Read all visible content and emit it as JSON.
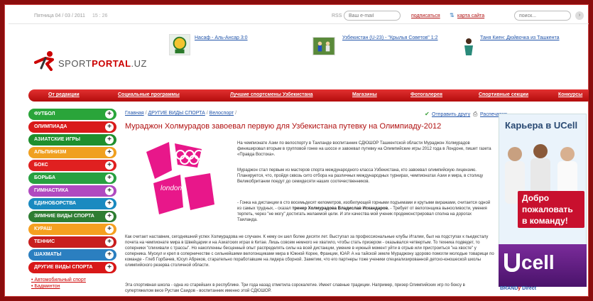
{
  "topbar": {
    "date": "Пятница 04 / 03 / 2011",
    "time": "15 : 26",
    "rss": "RSS",
    "email_placeholder": "Ваш e-mail",
    "subscribe": "подписаться",
    "sitemap": "карта сайта",
    "search_placeholder": "поиск..."
  },
  "logo": {
    "brand_plain": "SPORT",
    "brand_bold": "PORTAL",
    "brand_tail": ".UZ"
  },
  "header_news": [
    {
      "title": "Насаф - Аль-Ансар 3:0"
    },
    {
      "title": "Узбекистан (U-23) - \"Крылья Советов\" 1:2"
    },
    {
      "title": "Таня Киен: Дюйвочка из Ташкента"
    }
  ],
  "nav": {
    "items": [
      "От редакции",
      "Социальные программы",
      "Лучшие спортсмены Узбекистана",
      "Магазины",
      "Фотогалерея",
      "Спортивные секции",
      "Конкурсы"
    ]
  },
  "sidebar": {
    "items": [
      {
        "label": "ФУТБОЛ",
        "color": "#2aa53a"
      },
      {
        "label": "ОЛИМПИАДА",
        "color": "#d91a1a"
      },
      {
        "label": "АЗИАТСКИЕ ИГРЫ",
        "color": "#1f8f2e"
      },
      {
        "label": "АЛЬПИНИЗМ",
        "color": "#f0a020"
      },
      {
        "label": "БОКС",
        "color": "#e02020"
      },
      {
        "label": "БОРЬБА",
        "color": "#28a040"
      },
      {
        "label": "ГИМНАСТИКА",
        "color": "#b04ac0"
      },
      {
        "label": "ЕДИНОБОРСТВА",
        "color": "#1a8ac0"
      },
      {
        "label": "ЗИМНИЕ ВИДЫ СПОРТА",
        "color": "#2e7d32"
      },
      {
        "label": "КУРАШ",
        "color": "#f5a020"
      },
      {
        "label": "ТЕННИС",
        "color": "#c81e1e"
      },
      {
        "label": "ШАХМАТЫ",
        "color": "#2b7fc0"
      },
      {
        "label": "ДРУГИЕ ВИДЫ СПОРТА",
        "color": "#d81818"
      }
    ],
    "sub_links": [
      "Автомобильный спорт",
      "Бадминтон"
    ]
  },
  "breadcrumb": {
    "home": "Главная",
    "section": "ДРУГИЕ ВИДЫ СПОРТА",
    "current": "Велоспорт"
  },
  "actions": {
    "send": "Отправить другу",
    "print": "Распечатать"
  },
  "article": {
    "title": "Мураджон Холмурадов завоевал первую для Узбекистана путевку на Олимпиаду-2012",
    "logo_text": "london",
    "p1": "На чемпионате Азии по велоспорту в Таиланде воспитанник СДЮШОР Ташкентской области Мураджон Холмурадов финишировал вторым в групповой гонке на шоссе и завоевал путевку на Олимпийские игры 2012 года в Лондоне, пишет газета «Правда Востока».",
    "p2": "Мураджон стал первым из мастеров спорта международного класса Узбекистана, кто завоевал олимпийскую лицензию. Планируется, что, пройдя сквозь сито отбора на различных международных турнирах, чемпионатах Азии и мира, в столицу Великобритании поедут до семидесяти наших соотечественников.",
    "p3_a": "- Гонка на дистанции в сто восемьдесят километров, изобилующей горными подъемами и крутыми виражами, считается одной из самых трудных, - сказал ",
    "p3_bold": "тренер Холмурадова Владислав Искандаров.",
    "p3_b": " - Требует от велогонщика выносливости, умения терпеть, через \"не могу\" достигать желаемой цели. И эти качества мой ученик продемонстрировал сполна на дорогах Таиланда.",
    "p4": "Как считает наставник, сегодняшний успех Холмурадова не случаен. К нему он шел более десяти лет. Выступал за профессиональные клубы Италии, был на подступах к пьедесталу почета на чемпионате мира в Швейцарии и на Азиатских играх в Китае. Лишь совсем немного не хватило, чтобы стать призером - оказывался четвертым. То техника подведет, то соперники \"спихивали с трассы\". Но накопленны бесценный опыт распределять силы на всей дистанции, умение в нужный момент уйти в отрыв или пристроиться \"на хвосте\" у соперника. Мускул и креп в соперничестве с сильнейшими велогонщиками мира в Южной Корее, Франции, ЮАР. А на тайской земле Мураджону здорово помогли молодые товарищи по команде - Глеб Горбачев, Юсуп Абреков, старательно поработавшие на лидера сборной. Заметим, что его партнеры тоже ученики специализированной детско-юношеской школы олимпийского резерва столичной области.",
    "p5": "Эта спортивная школа - одна из старейших в республике. Три года назад отметила сорокалетие. Имеет славные традиции. Например, призер Олимпийских игр по боксу в супертяжелом весе Рустам Саидов - воспитанник именно этой СДЮШОР."
  },
  "ads": {
    "ad1_title": "Карьера в UCell",
    "ad1_slogan": "Добро пожаловать в команду!",
    "ad2_logo": "cell",
    "brand_a": "BRAND",
    "brand_b": "y",
    "brand_c": " Direct"
  }
}
